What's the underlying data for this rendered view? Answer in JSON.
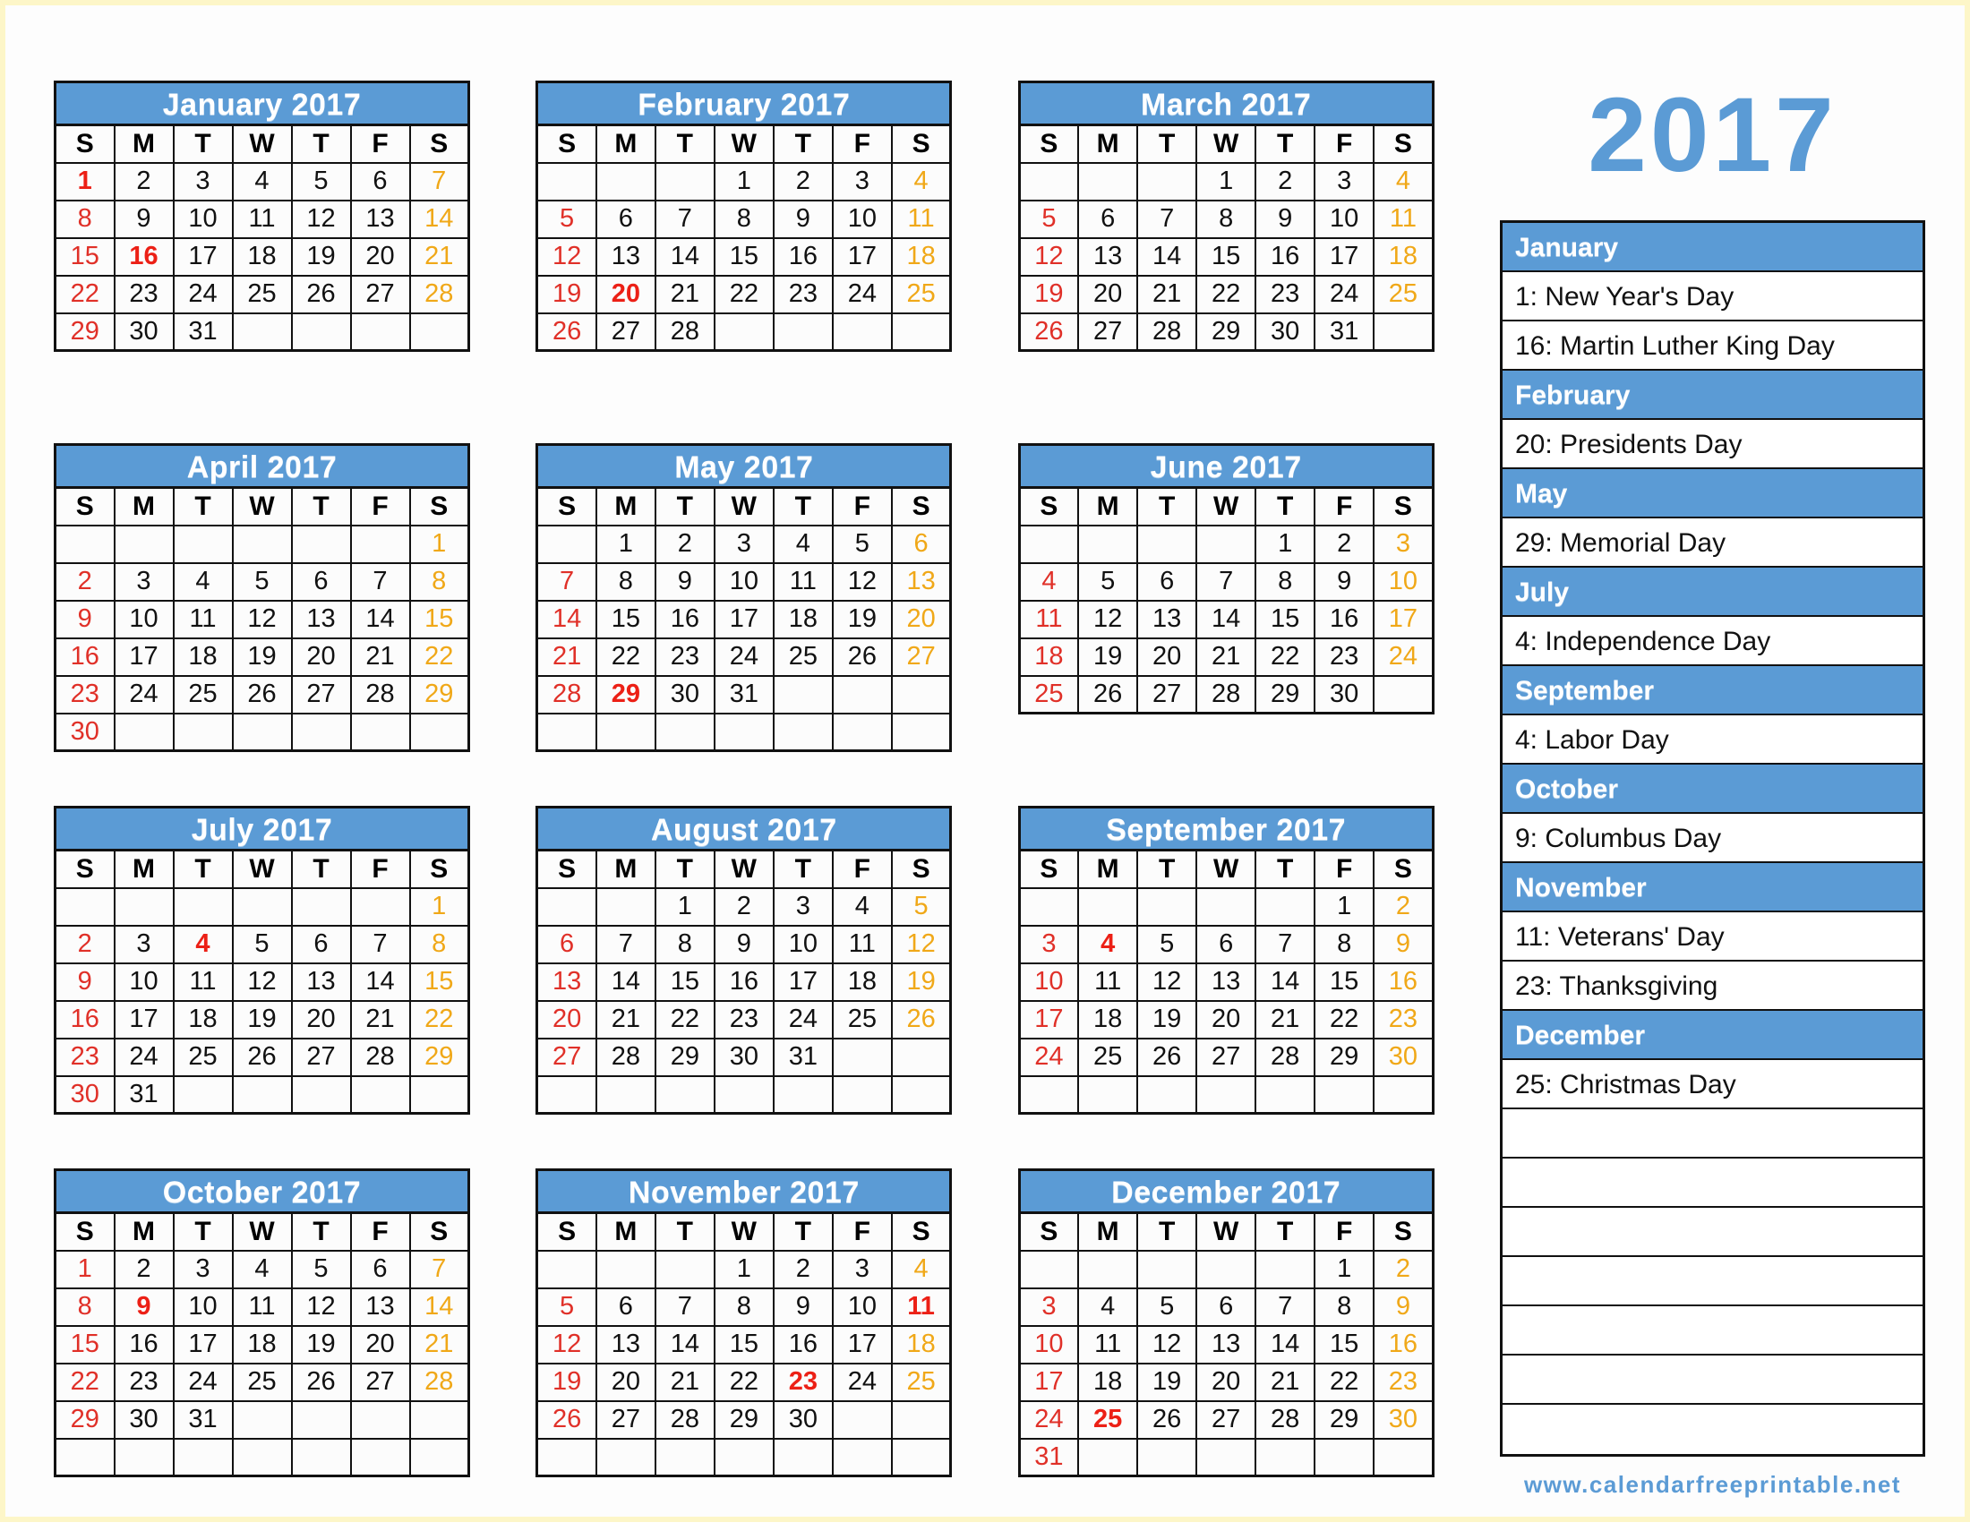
{
  "year_title": "2017",
  "site_url": "www.calendarfreeprintable.net",
  "colors": {
    "accent_blue": "#5b9bd5",
    "sunday_red": "#e03028",
    "saturday_gold": "#f0a818",
    "holiday_red": "#ec2016",
    "weekday_black": "#111111",
    "border_black": "#111111"
  },
  "weekday_headers": [
    "S",
    "M",
    "T",
    "W",
    "T",
    "F",
    "S"
  ],
  "months": [
    {
      "name": "January 2017",
      "weeks": [
        [
          "1",
          "2",
          "3",
          "4",
          "5",
          "6",
          "7"
        ],
        [
          "8",
          "9",
          "10",
          "11",
          "12",
          "13",
          "14"
        ],
        [
          "15",
          "16",
          "17",
          "18",
          "19",
          "20",
          "21"
        ],
        [
          "22",
          "23",
          "24",
          "25",
          "26",
          "27",
          "28"
        ],
        [
          "29",
          "30",
          "31",
          "",
          "",
          "",
          ""
        ]
      ],
      "holidays": [
        "1",
        "16"
      ]
    },
    {
      "name": "February 2017",
      "weeks": [
        [
          "",
          "",
          "",
          "1",
          "2",
          "3",
          "4"
        ],
        [
          "5",
          "6",
          "7",
          "8",
          "9",
          "10",
          "11"
        ],
        [
          "12",
          "13",
          "14",
          "15",
          "16",
          "17",
          "18"
        ],
        [
          "19",
          "20",
          "21",
          "22",
          "23",
          "24",
          "25"
        ],
        [
          "26",
          "27",
          "28",
          "",
          "",
          "",
          ""
        ]
      ],
      "holidays": [
        "20"
      ]
    },
    {
      "name": "March 2017",
      "weeks": [
        [
          "",
          "",
          "",
          "1",
          "2",
          "3",
          "4"
        ],
        [
          "5",
          "6",
          "7",
          "8",
          "9",
          "10",
          "11"
        ],
        [
          "12",
          "13",
          "14",
          "15",
          "16",
          "17",
          "18"
        ],
        [
          "19",
          "20",
          "21",
          "22",
          "23",
          "24",
          "25"
        ],
        [
          "26",
          "27",
          "28",
          "29",
          "30",
          "31",
          ""
        ]
      ],
      "holidays": []
    },
    {
      "name": "April 2017",
      "weeks": [
        [
          "",
          "",
          "",
          "",
          "",
          "",
          "1"
        ],
        [
          "2",
          "3",
          "4",
          "5",
          "6",
          "7",
          "8"
        ],
        [
          "9",
          "10",
          "11",
          "12",
          "13",
          "14",
          "15"
        ],
        [
          "16",
          "17",
          "18",
          "19",
          "20",
          "21",
          "22"
        ],
        [
          "23",
          "24",
          "25",
          "26",
          "27",
          "28",
          "29"
        ],
        [
          "30",
          "",
          "",
          "",
          "",
          "",
          ""
        ]
      ],
      "holidays": []
    },
    {
      "name": "May 2017",
      "weeks": [
        [
          "",
          "1",
          "2",
          "3",
          "4",
          "5",
          "6"
        ],
        [
          "7",
          "8",
          "9",
          "10",
          "11",
          "12",
          "13"
        ],
        [
          "14",
          "15",
          "16",
          "17",
          "18",
          "19",
          "20"
        ],
        [
          "21",
          "22",
          "23",
          "24",
          "25",
          "26",
          "27"
        ],
        [
          "28",
          "29",
          "30",
          "31",
          "",
          "",
          ""
        ],
        [
          "",
          "",
          "",
          "",
          "",
          "",
          ""
        ]
      ],
      "holidays": [
        "29"
      ]
    },
    {
      "name": "June 2017",
      "weeks": [
        [
          "",
          "",
          "",
          "",
          "1",
          "2",
          "3"
        ],
        [
          "4",
          "5",
          "6",
          "7",
          "8",
          "9",
          "10"
        ],
        [
          "11",
          "12",
          "13",
          "14",
          "15",
          "16",
          "17"
        ],
        [
          "18",
          "19",
          "20",
          "21",
          "22",
          "23",
          "24"
        ],
        [
          "25",
          "26",
          "27",
          "28",
          "29",
          "30",
          ""
        ]
      ],
      "holidays": []
    },
    {
      "name": "July 2017",
      "weeks": [
        [
          "",
          "",
          "",
          "",
          "",
          "",
          "1"
        ],
        [
          "2",
          "3",
          "4",
          "5",
          "6",
          "7",
          "8"
        ],
        [
          "9",
          "10",
          "11",
          "12",
          "13",
          "14",
          "15"
        ],
        [
          "16",
          "17",
          "18",
          "19",
          "20",
          "21",
          "22"
        ],
        [
          "23",
          "24",
          "25",
          "26",
          "27",
          "28",
          "29"
        ],
        [
          "30",
          "31",
          "",
          "",
          "",
          "",
          ""
        ]
      ],
      "holidays": [
        "4"
      ]
    },
    {
      "name": "August 2017",
      "weeks": [
        [
          "",
          "",
          "1",
          "2",
          "3",
          "4",
          "5"
        ],
        [
          "6",
          "7",
          "8",
          "9",
          "10",
          "11",
          "12"
        ],
        [
          "13",
          "14",
          "15",
          "16",
          "17",
          "18",
          "19"
        ],
        [
          "20",
          "21",
          "22",
          "23",
          "24",
          "25",
          "26"
        ],
        [
          "27",
          "28",
          "29",
          "30",
          "31",
          "",
          ""
        ],
        [
          "",
          "",
          "",
          "",
          "",
          "",
          ""
        ]
      ],
      "holidays": []
    },
    {
      "name": "September 2017",
      "weeks": [
        [
          "",
          "",
          "",
          "",
          "",
          "1",
          "2"
        ],
        [
          "3",
          "4",
          "5",
          "6",
          "7",
          "8",
          "9"
        ],
        [
          "10",
          "11",
          "12",
          "13",
          "14",
          "15",
          "16"
        ],
        [
          "17",
          "18",
          "19",
          "20",
          "21",
          "22",
          "23"
        ],
        [
          "24",
          "25",
          "26",
          "27",
          "28",
          "29",
          "30"
        ],
        [
          "",
          "",
          "",
          "",
          "",
          "",
          ""
        ]
      ],
      "holidays": [
        "4"
      ]
    },
    {
      "name": "October 2017",
      "weeks": [
        [
          "1",
          "2",
          "3",
          "4",
          "5",
          "6",
          "7"
        ],
        [
          "8",
          "9",
          "10",
          "11",
          "12",
          "13",
          "14"
        ],
        [
          "15",
          "16",
          "17",
          "18",
          "19",
          "20",
          "21"
        ],
        [
          "22",
          "23",
          "24",
          "25",
          "26",
          "27",
          "28"
        ],
        [
          "29",
          "30",
          "31",
          "",
          "",
          "",
          ""
        ],
        [
          "",
          "",
          "",
          "",
          "",
          "",
          ""
        ]
      ],
      "holidays": [
        "9"
      ]
    },
    {
      "name": "November 2017",
      "weeks": [
        [
          "",
          "",
          "",
          "1",
          "2",
          "3",
          "4"
        ],
        [
          "5",
          "6",
          "7",
          "8",
          "9",
          "10",
          "11"
        ],
        [
          "12",
          "13",
          "14",
          "15",
          "16",
          "17",
          "18"
        ],
        [
          "19",
          "20",
          "21",
          "22",
          "23",
          "24",
          "25"
        ],
        [
          "26",
          "27",
          "28",
          "29",
          "30",
          "",
          ""
        ],
        [
          "",
          "",
          "",
          "",
          "",
          "",
          ""
        ]
      ],
      "holidays": [
        "11",
        "23"
      ]
    },
    {
      "name": "December 2017",
      "weeks": [
        [
          "",
          "",
          "",
          "",
          "",
          "1",
          "2"
        ],
        [
          "3",
          "4",
          "5",
          "6",
          "7",
          "8",
          "9"
        ],
        [
          "10",
          "11",
          "12",
          "13",
          "14",
          "15",
          "16"
        ],
        [
          "17",
          "18",
          "19",
          "20",
          "21",
          "22",
          "23"
        ],
        [
          "24",
          "25",
          "26",
          "27",
          "28",
          "29",
          "30"
        ],
        [
          "31",
          "",
          "",
          "",
          "",
          "",
          ""
        ]
      ],
      "holidays": [
        "25"
      ]
    }
  ],
  "holiday_panel": {
    "rows": [
      {
        "type": "month",
        "text": "January"
      },
      {
        "type": "entry",
        "text": "1: New Year's Day"
      },
      {
        "type": "entry",
        "text": "16: Martin Luther King Day"
      },
      {
        "type": "month",
        "text": "February"
      },
      {
        "type": "entry",
        "text": "20: Presidents Day"
      },
      {
        "type": "month",
        "text": "May"
      },
      {
        "type": "entry",
        "text": "29: Memorial Day"
      },
      {
        "type": "month",
        "text": "July"
      },
      {
        "type": "entry",
        "text": "4: Independence Day"
      },
      {
        "type": "month",
        "text": "September"
      },
      {
        "type": "entry",
        "text": "4: Labor Day"
      },
      {
        "type": "month",
        "text": "October"
      },
      {
        "type": "entry",
        "text": "9: Columbus Day"
      },
      {
        "type": "month",
        "text": "November"
      },
      {
        "type": "entry",
        "text": "11: Veterans' Day"
      },
      {
        "type": "entry",
        "text": "23: Thanksgiving"
      },
      {
        "type": "month",
        "text": "December"
      },
      {
        "type": "entry",
        "text": "25: Christmas Day"
      },
      {
        "type": "blank",
        "text": ""
      },
      {
        "type": "blank",
        "text": ""
      },
      {
        "type": "blank",
        "text": ""
      },
      {
        "type": "blank",
        "text": ""
      },
      {
        "type": "blank",
        "text": ""
      },
      {
        "type": "blank",
        "text": ""
      },
      {
        "type": "blank",
        "text": ""
      }
    ]
  }
}
